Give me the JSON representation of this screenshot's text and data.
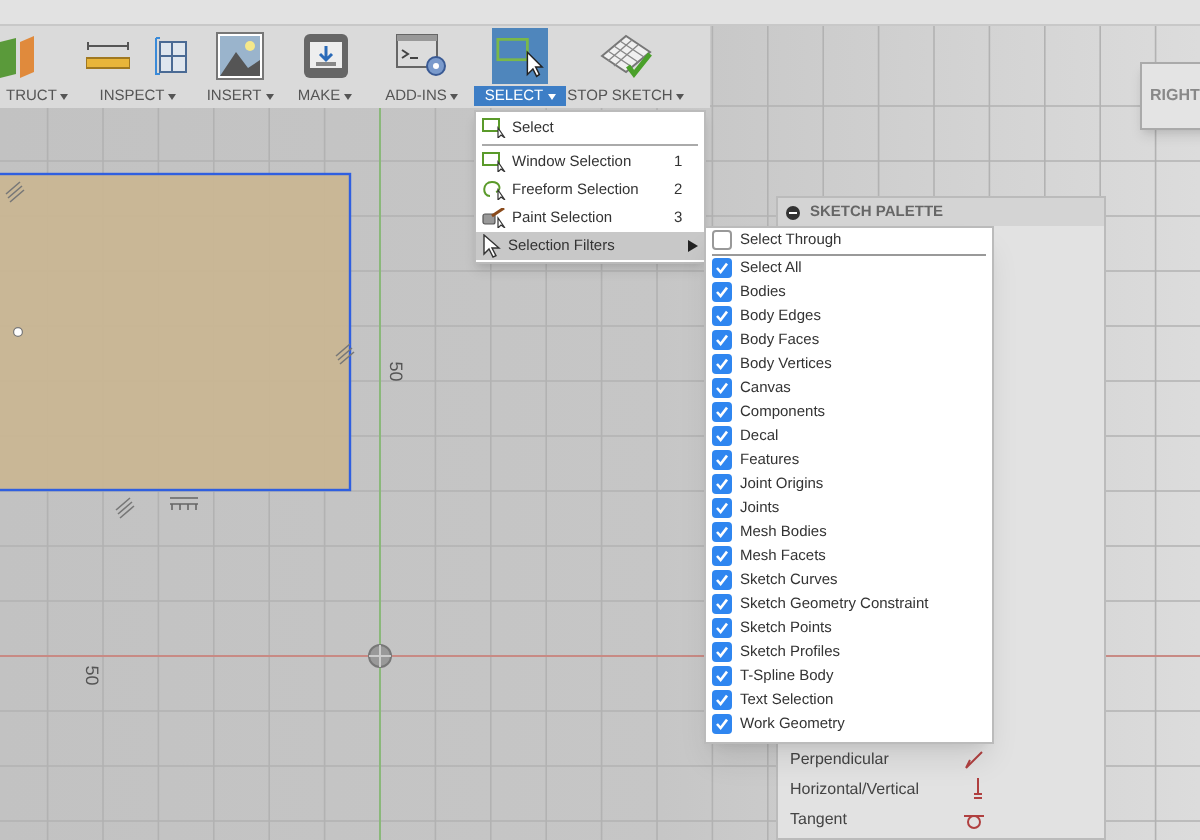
{
  "toolbar": {
    "groups": [
      {
        "label": "TRUCT",
        "selected": false
      },
      {
        "label": "INSPECT",
        "selected": false
      },
      {
        "label": "INSERT",
        "selected": false
      },
      {
        "label": "MAKE",
        "selected": false
      },
      {
        "label": "ADD-INS",
        "selected": false
      },
      {
        "label": "SELECT",
        "selected": true
      },
      {
        "label": "STOP SKETCH",
        "selected": false
      }
    ]
  },
  "select_menu": {
    "items": [
      {
        "label": "Select",
        "selected": false,
        "has_submenu": false
      },
      {
        "label": "Window Selection",
        "shortcut": "1",
        "selected": false,
        "has_submenu": false
      },
      {
        "label": "Freeform Selection",
        "shortcut": "2",
        "selected": false,
        "has_submenu": false
      },
      {
        "label": "Paint Selection",
        "shortcut": "3",
        "selected": false,
        "has_submenu": false
      },
      {
        "label": "Selection Filters",
        "selected": true,
        "has_submenu": true
      }
    ]
  },
  "filters_menu": {
    "items": [
      {
        "label": "Select Through",
        "checked": false
      },
      {
        "label": "Select All",
        "checked": true
      },
      {
        "label": "Bodies",
        "checked": true
      },
      {
        "label": "Body Edges",
        "checked": true
      },
      {
        "label": "Body Faces",
        "checked": true
      },
      {
        "label": "Body Vertices",
        "checked": true
      },
      {
        "label": "Canvas",
        "checked": true
      },
      {
        "label": "Components",
        "checked": true
      },
      {
        "label": "Decal",
        "checked": true
      },
      {
        "label": "Features",
        "checked": true
      },
      {
        "label": "Joint Origins",
        "checked": true
      },
      {
        "label": "Joints",
        "checked": true
      },
      {
        "label": "Mesh Bodies",
        "checked": true
      },
      {
        "label": "Mesh Facets",
        "checked": true
      },
      {
        "label": "Sketch Curves",
        "checked": true
      },
      {
        "label": "Sketch Geometry Constraint",
        "checked": true
      },
      {
        "label": "Sketch Points",
        "checked": true
      },
      {
        "label": "Sketch Profiles",
        "checked": true
      },
      {
        "label": "T-Spline Body",
        "checked": true
      },
      {
        "label": "Text Selection",
        "checked": true
      },
      {
        "label": "Work Geometry",
        "checked": true
      }
    ]
  },
  "sketch_palette": {
    "title": "SKETCH PALETTE",
    "constraints": [
      {
        "label": "Perpendicular"
      },
      {
        "label": "Horizontal/Vertical"
      },
      {
        "label": "Tangent"
      }
    ]
  },
  "canvas": {
    "dimension_labels": [
      "50",
      "50"
    ]
  },
  "view_cube": {
    "face": "RIGHT"
  }
}
